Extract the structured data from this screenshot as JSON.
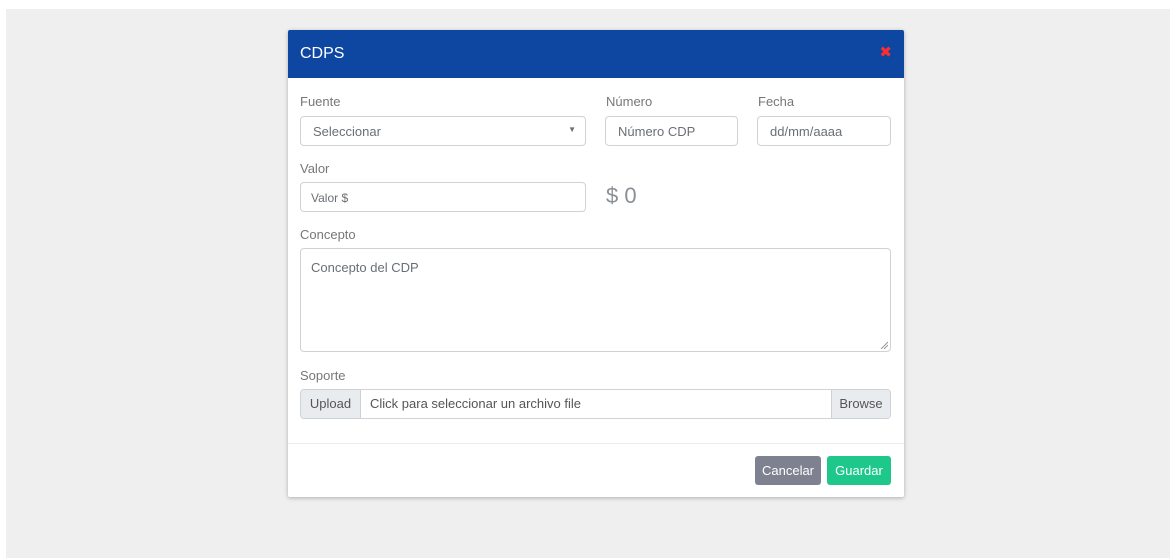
{
  "modal": {
    "title": "CDPS",
    "close_symbol": "✖"
  },
  "form": {
    "fuente": {
      "label": "Fuente",
      "selected": "Seleccionar"
    },
    "numero": {
      "label": "Número",
      "placeholder": "Número CDP"
    },
    "fecha": {
      "label": "Fecha",
      "placeholder": "dd/mm/aaaa"
    },
    "valor": {
      "label": "Valor",
      "placeholder": "Valor $",
      "display": "$ 0"
    },
    "concepto": {
      "label": "Concepto",
      "placeholder": "Concepto del CDP"
    },
    "soporte": {
      "label": "Soporte",
      "prefix": "Upload",
      "file_text": "Click para seleccionar un archivo file",
      "browse": "Browse"
    }
  },
  "footer": {
    "cancel": "Cancelar",
    "save": "Guardar"
  },
  "colors": {
    "header": "#0d47a1",
    "close": "#ff2d2d",
    "cancel": "#7e8290",
    "save": "#1ec88a"
  },
  "icons": {
    "close": "close-icon",
    "caret": "chevron-down-icon",
    "resize": "resize-grip-icon"
  }
}
